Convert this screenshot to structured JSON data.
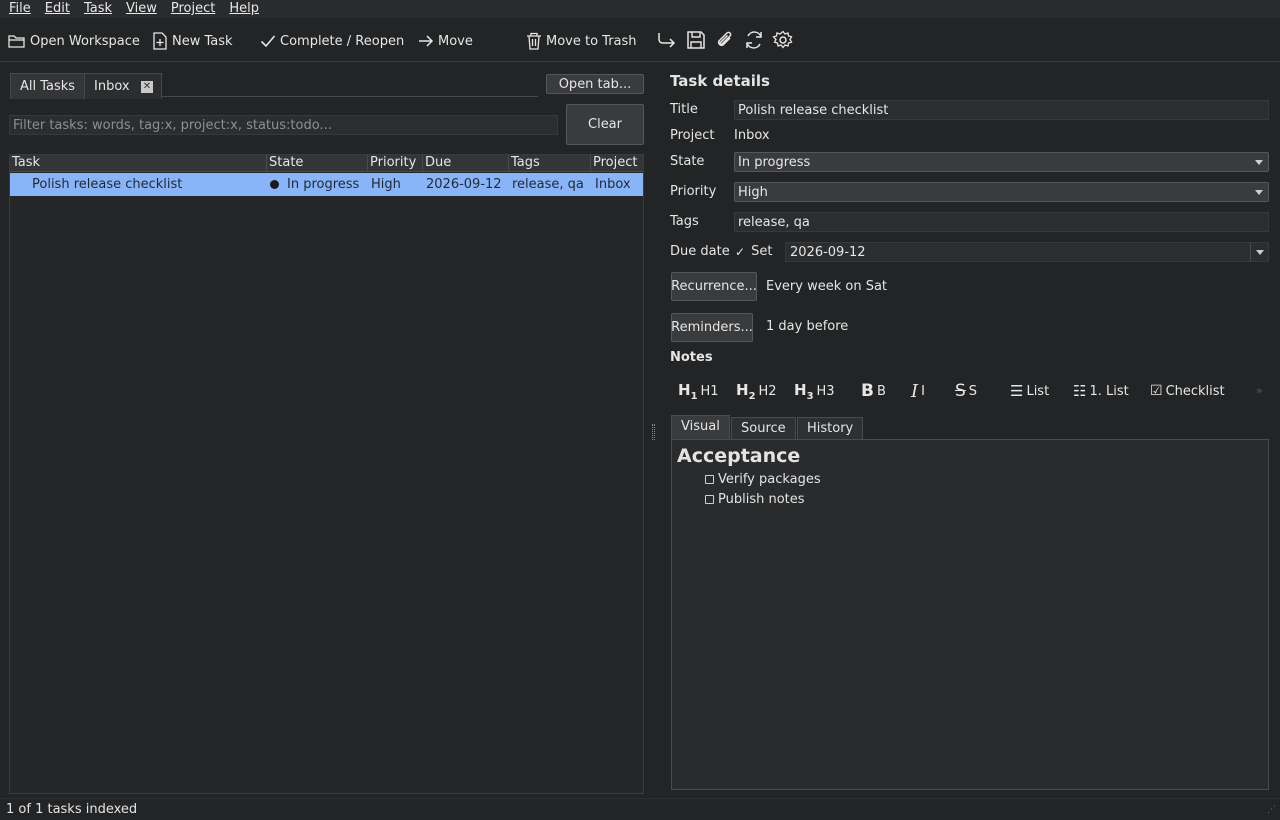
{
  "menu": [
    "File",
    "Edit",
    "Task",
    "View",
    "Project",
    "Help"
  ],
  "toolbar": {
    "open_workspace": "Open Workspace",
    "new_task": "New Task",
    "complete_reopen": "Complete / Reopen",
    "move": "Move",
    "move_to_trash": "Move to Trash",
    "icons": [
      "redirect-icon",
      "save-icon",
      "attachment-icon",
      "sync-icon",
      "settings-icon"
    ]
  },
  "tabs": {
    "all_tasks": "All Tasks",
    "inbox": "Inbox",
    "open_tab": "Open tab..."
  },
  "filter": {
    "placeholder": "Filter tasks: words, tag:x, project:x, status:todo...",
    "clear": "Clear"
  },
  "table": {
    "headers": [
      "Task",
      "State",
      "Priority",
      "Due",
      "Tags",
      "Project"
    ],
    "rows": [
      {
        "task": "Polish release checklist",
        "state": "In progress",
        "priority": "High",
        "due": "2026-09-12",
        "tags": "release, qa",
        "project": "Inbox"
      }
    ]
  },
  "details": {
    "heading": "Task details",
    "title_label": "Title",
    "title_value": "Polish release checklist",
    "project_label": "Project",
    "project_value": "Inbox",
    "state_label": "State",
    "state_value": "In progress",
    "priority_label": "Priority",
    "priority_value": "High",
    "tags_label": "Tags",
    "tags_value": "release, qa",
    "due_label": "Due date",
    "due_set": "Set",
    "due_value": "2026-09-12",
    "recurrence_button": "Recurrence...",
    "recurrence_value": "Every week on Sat",
    "reminders_button": "Reminders...",
    "reminders_value": "1 day before",
    "notes_label": "Notes"
  },
  "format_toolbar": {
    "h1": "H1",
    "h2": "H2",
    "h3": "H3",
    "bold": "B",
    "italic": "I",
    "strike": "S",
    "list": "List",
    "numbered": "1. List",
    "checklist": "Checklist"
  },
  "notes_tabs": [
    "Visual",
    "Source",
    "History"
  ],
  "notes": {
    "heading": "Acceptance",
    "items": [
      "Verify packages",
      "Publish notes"
    ]
  },
  "status": "1 of 1 tasks indexed",
  "colors": {
    "selection": "#8ab4f8",
    "background": "#232425"
  }
}
